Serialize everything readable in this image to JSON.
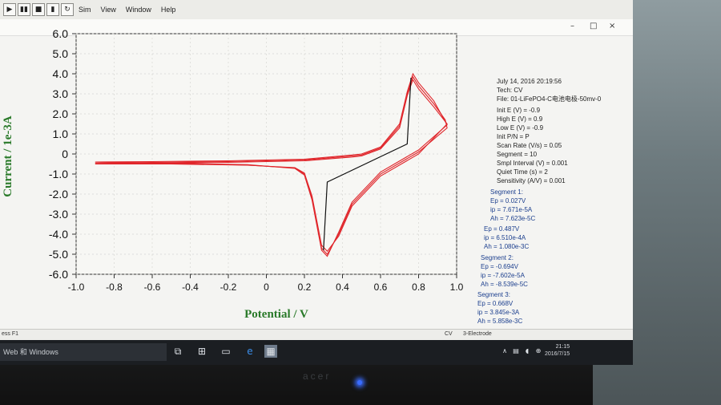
{
  "menu": {
    "toolbar_glyphs": [
      "▶",
      "▮▮",
      "■",
      "▮",
      "↻"
    ],
    "items": [
      "Sim",
      "View",
      "Window",
      "Help"
    ]
  },
  "window_controls": {
    "minimize": "–",
    "maximize": "□",
    "close": "×"
  },
  "chart_data": {
    "type": "line",
    "xlabel": "Potential / V",
    "ylabel": "Current / 1e-3A",
    "xlim": [
      -1.0,
      1.0
    ],
    "ylim": [
      -6.0,
      6.0
    ],
    "x_ticks": [
      "-1.0",
      "-0.8",
      "-0.6",
      "-0.4",
      "-0.2",
      "0",
      "0.2",
      "0.4",
      "0.6",
      "0.8",
      "1.0"
    ],
    "y_ticks": [
      "6.0",
      "5.0",
      "4.0",
      "3.0",
      "2.0",
      "1.0",
      "0",
      "-1.0",
      "-2.0",
      "-3.0",
      "-4.0",
      "-5.0",
      "-6.0"
    ],
    "grid": true,
    "colors": {
      "cv": "#e0262b",
      "baseline": "#111111",
      "axis_label": "#2a7a2a"
    },
    "series": [
      {
        "points": [
          [
            -0.9,
            -0.45
          ],
          [
            -0.6,
            -0.42
          ],
          [
            -0.2,
            -0.38
          ],
          [
            0.2,
            -0.3
          ],
          [
            0.45,
            -0.1
          ],
          [
            0.5,
            -0.05
          ],
          [
            0.6,
            0.3
          ],
          [
            0.7,
            1.4
          ],
          [
            0.74,
            3.0
          ],
          [
            0.77,
            3.85
          ],
          [
            0.8,
            3.4
          ],
          [
            0.88,
            2.5
          ],
          [
            0.94,
            1.7
          ],
          [
            0.95,
            1.3
          ],
          [
            0.8,
            0.1
          ],
          [
            0.6,
            -1.0
          ],
          [
            0.45,
            -2.5
          ],
          [
            0.38,
            -4.0
          ],
          [
            0.32,
            -5.0
          ],
          [
            0.29,
            -4.7
          ],
          [
            0.24,
            -2.2
          ],
          [
            0.2,
            -1.0
          ],
          [
            0.15,
            -0.7
          ],
          [
            -0.1,
            -0.55
          ],
          [
            -0.5,
            -0.48
          ],
          [
            -0.9,
            -0.45
          ]
        ]
      },
      {
        "points": [
          [
            -0.9,
            -0.5
          ],
          [
            -0.6,
            -0.46
          ],
          [
            -0.2,
            -0.42
          ],
          [
            0.2,
            -0.34
          ],
          [
            0.45,
            -0.15
          ],
          [
            0.5,
            -0.1
          ],
          [
            0.6,
            0.25
          ],
          [
            0.7,
            1.3
          ],
          [
            0.74,
            2.9
          ],
          [
            0.77,
            3.7
          ],
          [
            0.8,
            3.25
          ],
          [
            0.88,
            2.35
          ],
          [
            0.95,
            1.5
          ],
          [
            0.8,
            0.0
          ],
          [
            0.6,
            -1.1
          ],
          [
            0.45,
            -2.6
          ],
          [
            0.38,
            -4.1
          ],
          [
            0.32,
            -4.85
          ],
          [
            0.29,
            -4.55
          ],
          [
            0.24,
            -2.1
          ],
          [
            0.2,
            -0.95
          ],
          [
            0.15,
            -0.68
          ],
          [
            -0.1,
            -0.56
          ],
          [
            -0.5,
            -0.5
          ],
          [
            -0.9,
            -0.5
          ]
        ]
      },
      {
        "points": [
          [
            -0.9,
            -0.4
          ],
          [
            -0.6,
            -0.38
          ],
          [
            -0.2,
            -0.34
          ],
          [
            0.2,
            -0.26
          ],
          [
            0.45,
            -0.05
          ],
          [
            0.5,
            0.0
          ],
          [
            0.6,
            0.35
          ],
          [
            0.7,
            1.5
          ],
          [
            0.74,
            3.1
          ],
          [
            0.77,
            4.0
          ],
          [
            0.8,
            3.55
          ],
          [
            0.88,
            2.65
          ],
          [
            0.95,
            1.45
          ],
          [
            0.8,
            0.2
          ],
          [
            0.6,
            -0.9
          ],
          [
            0.45,
            -2.4
          ],
          [
            0.38,
            -3.9
          ],
          [
            0.32,
            -5.1
          ],
          [
            0.29,
            -4.8
          ],
          [
            0.24,
            -2.3
          ],
          [
            0.2,
            -1.05
          ],
          [
            0.15,
            -0.72
          ],
          [
            -0.1,
            -0.53
          ],
          [
            -0.5,
            -0.46
          ],
          [
            -0.9,
            -0.4
          ]
        ]
      }
    ],
    "baselines": [
      {
        "points": [
          [
            0.3,
            -4.8
          ],
          [
            0.32,
            -1.4
          ],
          [
            0.74,
            0.5
          ],
          [
            0.76,
            3.8
          ]
        ]
      }
    ]
  },
  "info": {
    "lines": [
      "July 14, 2016   20:19:56",
      "Tech: CV",
      "File: 01-LiFePO4-C电池电极-50mv-0"
    ],
    "params": [
      "Init E (V) = -0.9",
      "High E (V) = 0.9",
      "Low E (V) = -0.9",
      "Init P/N = P",
      "Scan Rate (V/s) = 0.05",
      "Segment = 10",
      "Smpl Interval (V) = 0.001",
      "Quiet Time (s) = 2",
      "Sensitivity (A/V) = 0.001"
    ],
    "segments": [
      [
        "Segment 1:",
        "Ep = 0.027V",
        "ip = 7.671e-5A",
        "Ah = 7.623e-5C"
      ],
      [
        "Ep = 0.487V",
        "ip = 6.510e-4A",
        "Ah = 1.080e-3C"
      ],
      [
        "Segment 2:",
        "Ep = -0.694V",
        "ip = -7.602e-5A",
        "Ah = -8.539e-5C"
      ],
      [
        "Segment 3:",
        "Ep = 0.668V",
        "ip = 3.845e-3A",
        "Ah = 5.858e-3C"
      ]
    ]
  },
  "status": {
    "left": "ess F1",
    "mid": "CV",
    "right": "3-Electrode"
  },
  "taskbar": {
    "search_text": "Web 和 Windows",
    "icons": [
      "task-view-icon",
      "store-icon",
      "file-explorer-icon",
      "edge-icon",
      "app-icon"
    ],
    "time": "21:15",
    "date": "2016/7/15"
  },
  "monitor_brand": "acer"
}
